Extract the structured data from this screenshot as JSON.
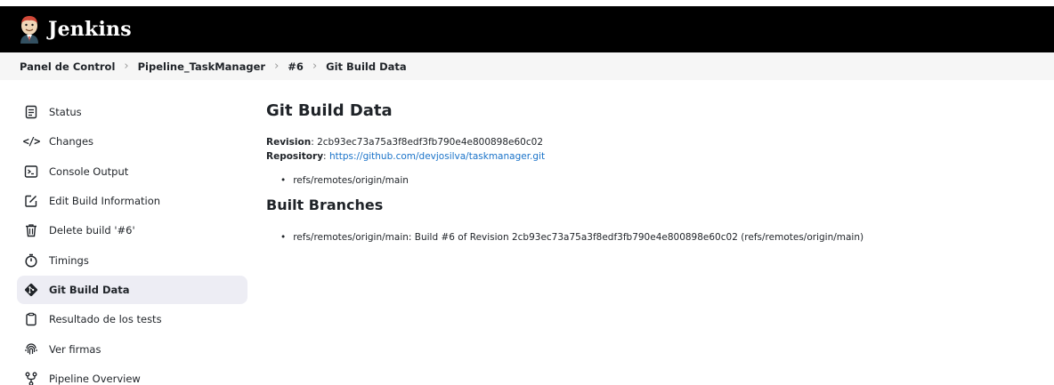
{
  "header": {
    "brand": "Jenkins"
  },
  "breadcrumb": [
    "Panel de Control",
    "Pipeline_TaskManager",
    "#6",
    "Git Build Data"
  ],
  "sidebar": {
    "items": [
      {
        "label": "Status",
        "icon": "notepad-icon"
      },
      {
        "label": "Changes",
        "icon": "code-icon"
      },
      {
        "label": "Console Output",
        "icon": "terminal-icon"
      },
      {
        "label": "Edit Build Information",
        "icon": "edit-icon"
      },
      {
        "label": "Delete build '#6'",
        "icon": "trash-icon"
      },
      {
        "label": "Timings",
        "icon": "stopwatch-icon"
      },
      {
        "label": "Git Build Data",
        "icon": "git-icon",
        "active": true
      },
      {
        "label": "Resultado de los tests",
        "icon": "clipboard-icon"
      },
      {
        "label": "Ver firmas",
        "icon": "fingerprint-icon"
      },
      {
        "label": "Pipeline Overview",
        "icon": "pipeline-icon"
      }
    ]
  },
  "main": {
    "title": "Git Build Data",
    "revision_label": "Revision",
    "revision_value": "2cb93ec73a75a3f8edf3fb790e4e800898e60c02",
    "repository_label": "Repository",
    "repository_url": "https://github.com/devjosilva/taskmanager.git",
    "refs": [
      "refs/remotes/origin/main"
    ],
    "built_branches_title": "Built Branches",
    "built_branches": [
      "refs/remotes/origin/main: Build #6 of Revision 2cb93ec73a75a3f8edf3fb790e4e800898e60c02 (refs/remotes/origin/main)"
    ]
  },
  "colors": {
    "header_bg": "#000000",
    "breadcrumb_bg": "#f6f6f6",
    "active_item_bg": "#ededf4",
    "link": "#1a73c9"
  }
}
